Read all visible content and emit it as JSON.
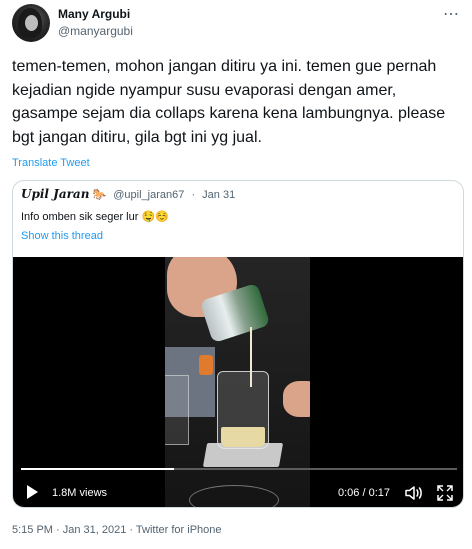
{
  "author": {
    "name": "Many Argubi",
    "handle": "@manyargubi",
    "more_icon": "more-icon"
  },
  "tweet": {
    "text": "temen-temen, mohon jangan ditiru ya ini. temen gue pernah kejadian ngide nyampur susu evaporasi dengan amer, gasampe sejam dia collaps karena kena lambungnya. please bgt jangan ditiru, gila bgt ini yg jual.",
    "translate_label": "Translate Tweet"
  },
  "quote": {
    "name": "𝕌𝕡𝕚𝕝 ℑ𝔞𝔯𝔞𝔫",
    "name_plain": "Upil Jaran",
    "emoji": "🐎",
    "handle": "@upil_jaran67",
    "separator": "·",
    "date": "Jan 31",
    "text": "Info omben sik seger lur 🤤☺️",
    "show_thread": "Show this thread"
  },
  "video": {
    "views": "1.8M views",
    "time": "0:06 / 0:17",
    "progress": 0.35,
    "volume_icon": "volume-icon",
    "fullscreen_icon": "fullscreen-icon",
    "play_icon": "play-icon"
  },
  "footer": {
    "text": "5:15 PM · Jan 31, 2021 · Twitter for iPhone"
  },
  "colors": {
    "link": "#1d9bf0",
    "muted": "#536471",
    "text": "#0f1419",
    "border": "#cfd9de"
  }
}
